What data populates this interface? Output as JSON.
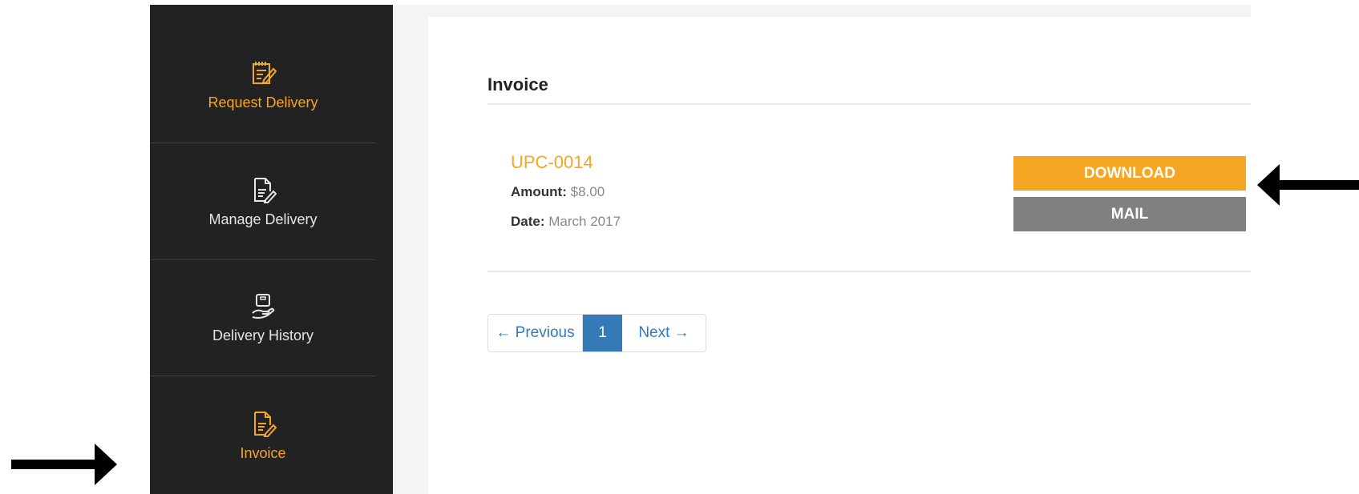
{
  "sidebar": {
    "items": [
      {
        "label": "Request Delivery",
        "icon": "notepad-pencil-icon"
      },
      {
        "label": "Manage Delivery",
        "icon": "document-pen-icon"
      },
      {
        "label": "Delivery History",
        "icon": "hand-package-icon"
      },
      {
        "label": "Invoice",
        "icon": "invoice-pen-icon"
      }
    ]
  },
  "main": {
    "title": "Invoice",
    "invoice": {
      "number": "UPC-0014",
      "amount_label": "Amount:",
      "amount_value": "$8.00",
      "date_label": "Date:",
      "date_value": "March 2017"
    },
    "buttons": {
      "download": "DOWNLOAD",
      "mail": "MAIL"
    },
    "pagination": {
      "prev": "← Previous",
      "current": "1",
      "next": "Next →"
    }
  },
  "colors": {
    "accent": "#f5a623",
    "sidebar_bg": "#222222",
    "mail_button": "#808080",
    "pagination_active": "#337ab7"
  }
}
